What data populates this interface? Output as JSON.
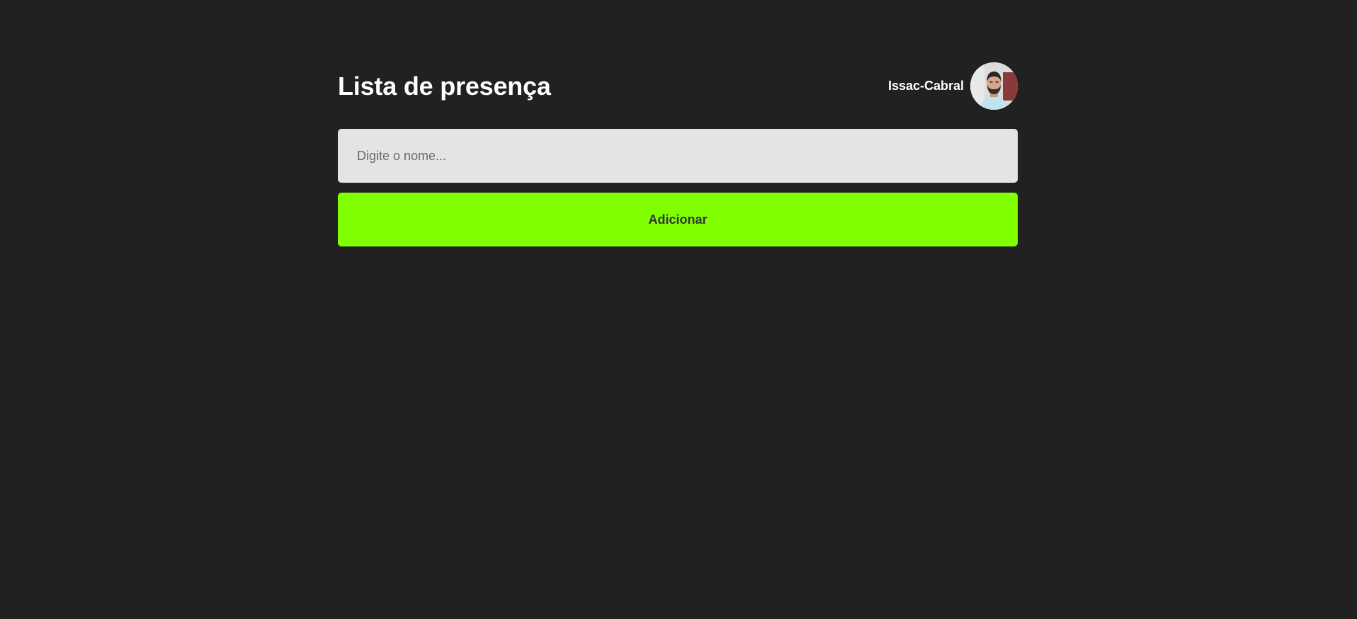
{
  "header": {
    "title": "Lista de presença",
    "user": {
      "name": "Issac-Cabral",
      "avatar_icon": "user-photo"
    }
  },
  "form": {
    "name_input": {
      "placeholder": "Digite o nome...",
      "value": ""
    },
    "add_button_label": "Adicionar"
  },
  "colors": {
    "background": "#212121",
    "input_background": "#e4e4e4",
    "button_background": "#7fff00",
    "button_text": "#333333",
    "title_text": "#ffffff"
  }
}
